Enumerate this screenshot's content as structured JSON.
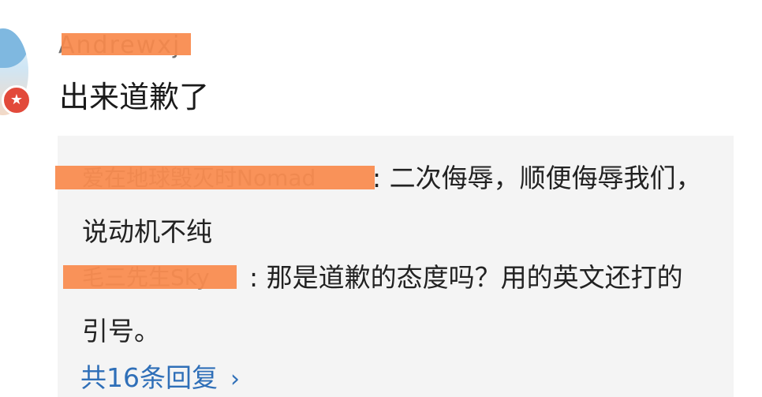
{
  "comment": {
    "username": "Andrewxj",
    "text": "出来道歉了"
  },
  "replies": [
    {
      "username": "爱在地球毁灭时Nomad",
      "separator": ":",
      "text": " 二次侮辱，顺便侮辱我们，说动机不纯"
    },
    {
      "username": "毛三先生Sky",
      "separator": ":",
      "text": " 那是道歉的态度吗？用的英文还打的引号。"
    }
  ],
  "more_replies": {
    "label": "共16条回复",
    "icon": "chevron-right-icon"
  },
  "colors": {
    "redaction": "#f9894b",
    "link": "#2f6fb8",
    "reply_bg": "#f4f4f4",
    "badge": "#e24a3b"
  }
}
